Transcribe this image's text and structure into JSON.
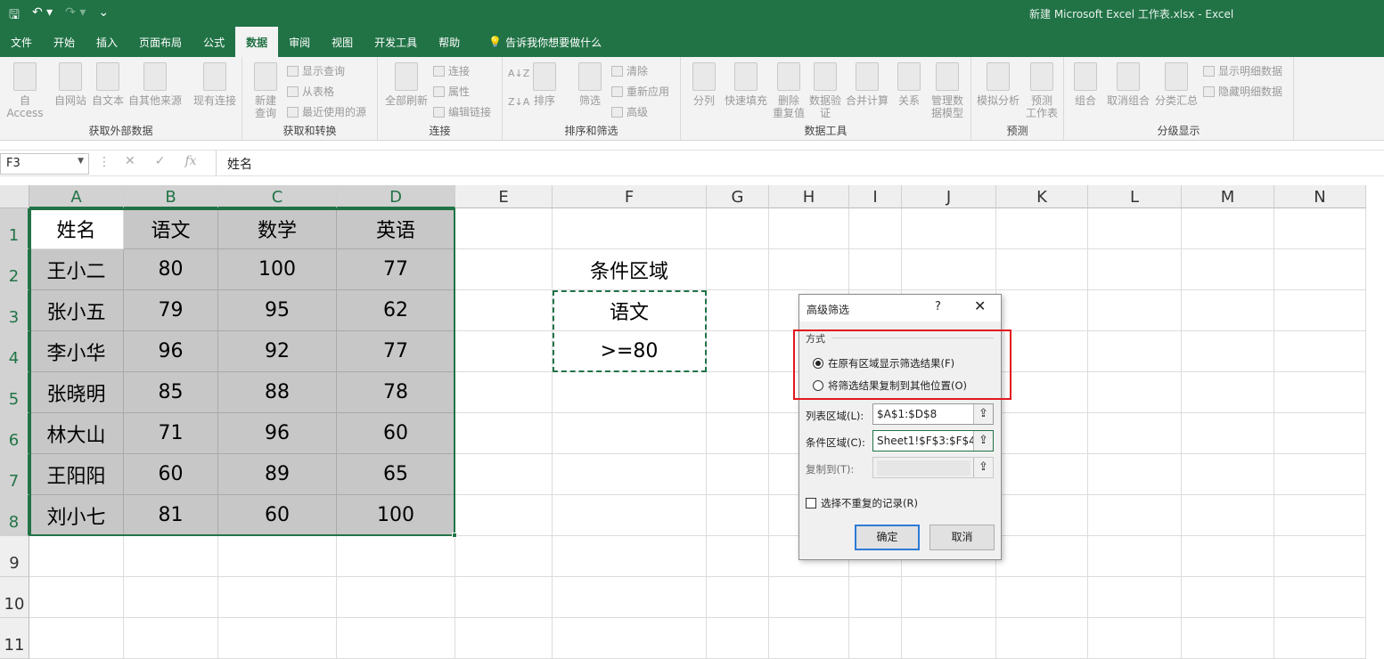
{
  "window": {
    "title": "新建 Microsoft Excel 工作表.xlsx  -  Excel"
  },
  "qat": {
    "save": "🖫",
    "undo": "↶ ▾",
    "redo": "↷ ▾",
    "customize": "⌄"
  },
  "tabs": [
    "文件",
    "开始",
    "插入",
    "页面布局",
    "公式",
    "数据",
    "审阅",
    "视图",
    "开发工具",
    "帮助"
  ],
  "active_tab": "数据",
  "tell_me": "告诉我你想要做什么",
  "ribbon": {
    "groups": {
      "external": "获取外部数据",
      "transform": "获取和转换",
      "connections": "连接",
      "sortfilter": "排序和筛选",
      "datatools": "数据工具",
      "forecast": "预测",
      "outline": "分级显示"
    },
    "external_btns": [
      "自 Access",
      "自网站",
      "自文本",
      "自其他来源",
      "现有连接"
    ],
    "transform_big": "新建\n查询",
    "transform_small": [
      "显示查询",
      "从表格",
      "最近使用的源"
    ],
    "conn_big": "全部刷新",
    "conn_small": [
      "连接",
      "属性",
      "编辑链接"
    ],
    "sort_btns": [
      "排序",
      "筛选"
    ],
    "sort_small": [
      "清除",
      "重新应用",
      "高级"
    ],
    "tools_btns": [
      "分列",
      "快速填充",
      "删除\n重复值",
      "数据验\n证",
      "合并计算",
      "关系",
      "管理数\n据模型"
    ],
    "forecast_btns": [
      "模拟分析",
      "预测\n工作表"
    ],
    "outline_btns": [
      "组合",
      "取消组合",
      "分类汇总"
    ],
    "outline_small": [
      "显示明细数据",
      "隐藏明细数据"
    ]
  },
  "formula_bar": {
    "name_box": "F3",
    "formula": "姓名",
    "fx": "fx",
    "cancel": "✕",
    "enter": "✓"
  },
  "columns": [
    "A",
    "B",
    "C",
    "D",
    "E",
    "F",
    "G",
    "H",
    "I",
    "J",
    "K",
    "L",
    "M",
    "N"
  ],
  "rows": [
    "1",
    "2",
    "3",
    "4",
    "5",
    "6",
    "7",
    "8",
    "9",
    "10",
    "11"
  ],
  "table": {
    "header": [
      "姓名",
      "语文",
      "数学",
      "英语"
    ],
    "rows": [
      [
        "王小二",
        "80",
        "100",
        "77"
      ],
      [
        "张小五",
        "79",
        "95",
        "62"
      ],
      [
        "李小华",
        "96",
        "92",
        "77"
      ],
      [
        "张晓明",
        "85",
        "88",
        "78"
      ],
      [
        "林大山",
        "71",
        "96",
        "60"
      ],
      [
        "王阳阳",
        "60",
        "89",
        "65"
      ],
      [
        "刘小七",
        "81",
        "60",
        "100"
      ]
    ]
  },
  "criteria": {
    "title": "条件区域",
    "field": "语文",
    "value": ">=80"
  },
  "dialog": {
    "title": "高级筛选",
    "help": "?",
    "close": "✕",
    "method_label": "方式",
    "option1": "在原有区域显示筛选结果(F)",
    "option2": "将筛选结果复制到其他位置(O)",
    "list_label": "列表区域(L):",
    "list_value": "$A$1:$D$8",
    "criteria_label": "条件区域(C):",
    "criteria_value": "Sheet1!$F$3:$F$4",
    "copyto_label": "复制到(T):",
    "unique_label": "选择不重复的记录(R)",
    "ok": "确定",
    "cancel": "取消",
    "collapse_icon": "⇪"
  },
  "colors": {
    "excel_green": "#217346",
    "highlight_red": "#e3161d"
  }
}
